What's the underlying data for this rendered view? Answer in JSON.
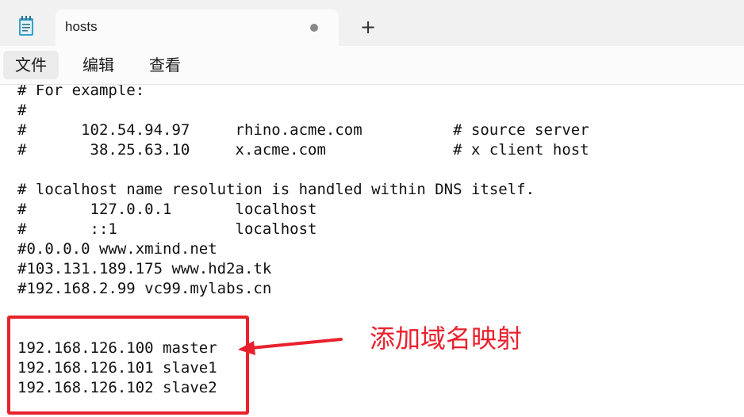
{
  "window": {
    "tab_title": "hosts",
    "new_tab_symbol": "+"
  },
  "menu": {
    "file": "文件",
    "edit": "编辑",
    "view": "查看"
  },
  "editor": {
    "lines": [
      "# For example:",
      "#",
      "#      102.54.94.97     rhino.acme.com          # source server",
      "#       38.25.63.10     x.acme.com              # x client host",
      "",
      "# localhost name resolution is handled within DNS itself.",
      "#       127.0.0.1       localhost",
      "#       ::1             localhost",
      "#0.0.0.0 www.xmind.net",
      "#103.131.189.175 www.hd2a.tk",
      "#192.168.2.99 vc99.mylabs.cn",
      "",
      "",
      "192.168.126.100 master",
      "192.168.126.101 slave1",
      "192.168.126.102 slave2"
    ]
  },
  "annotation": {
    "text": "添加域名映射",
    "color": "#e8212d"
  },
  "icons": {
    "app": "notepad-icon",
    "unsaved": "unsaved-dot-icon",
    "arrow": "arrow-left-icon"
  }
}
